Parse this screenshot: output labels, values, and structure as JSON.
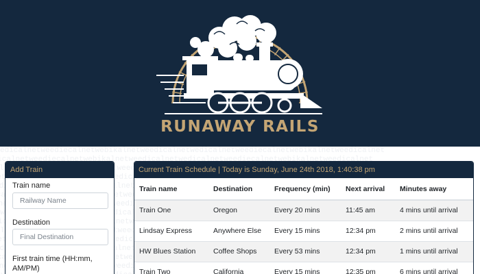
{
  "header": {
    "brand": "RUNAWAY RAILS",
    "logo_icon": "steam-locomotive-icon",
    "colors": {
      "navy": "#14283e",
      "gold": "#c4a574"
    }
  },
  "watermark_text": "edicalnetweediecalnetwebikalnetweedicalnetwedicalnetweediecalnetwebikalnetweedicalnet",
  "add_train": {
    "title": "Add Train",
    "fields": [
      {
        "label": "Train name",
        "placeholder": "Railway Name"
      },
      {
        "label": "Destination",
        "placeholder": "Final Destination"
      },
      {
        "label": "First train time (HH:mm, AM/PM)"
      }
    ]
  },
  "schedule": {
    "title": "Current Train Schedule | Today is Sunday, June 24th 2018, 1:40:38 pm",
    "columns": [
      "Train name",
      "Destination",
      "Frequency (min)",
      "Next arrival",
      "Minutes away"
    ],
    "rows": [
      [
        "Train One",
        "Oregon",
        "Every 20 mins",
        "11:45 am",
        "4 mins until arrival"
      ],
      [
        "Lindsay Express",
        "Anywhere Else",
        "Every 15 mins",
        "12:34 pm",
        "2 mins until arrival"
      ],
      [
        "HW Blues Station",
        "Coffee Shops",
        "Every 53 mins",
        "12:34 pm",
        "1 mins until arrival"
      ],
      [
        "Train Two",
        "California",
        "Every 15 mins",
        "12:35 pm",
        "6 mins until arrival"
      ]
    ]
  }
}
